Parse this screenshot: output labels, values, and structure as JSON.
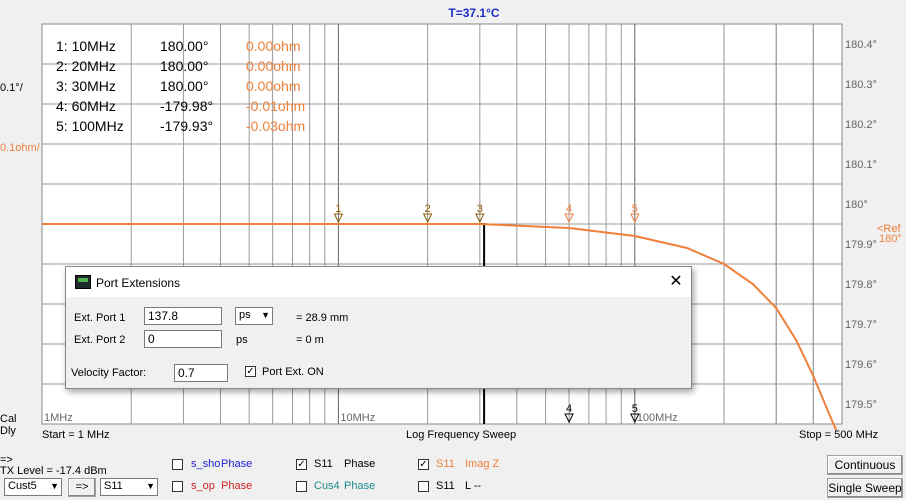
{
  "chart_data": {
    "type": "line",
    "title": "T=37.1°C",
    "x_scale": "log",
    "xlim": [
      1,
      500
    ],
    "x_tick_labels": [
      "1MHz",
      "10MHz",
      "100MHz"
    ],
    "y_tick_labels_right": [
      "180.4°",
      "180.3°",
      "180.2°",
      "180.1°",
      "180°",
      "179.9°",
      "179.8°",
      "179.7°",
      "179.6°",
      "179.5°"
    ],
    "ylim": [
      179.5,
      180.5
    ],
    "scale_labels": {
      "phase": "0.1°/",
      "imag": "0.1ohm/"
    },
    "ref_label": "<Ref",
    "ref_value": "180°",
    "series": [
      {
        "name": "S11 Phase",
        "color": "#000000",
        "x": [
          1,
          3,
          20,
          31,
          31
        ],
        "y": [
          180,
          180,
          180,
          180,
          179.5
        ]
      },
      {
        "name": "S11 Imag Z",
        "color": "#f07f3a",
        "x": [
          1,
          10,
          30,
          60,
          100,
          150,
          200,
          250,
          300,
          350,
          400,
          450,
          500
        ],
        "y": [
          180,
          180,
          180,
          179.99,
          179.97,
          179.94,
          179.9,
          179.85,
          179.79,
          179.71,
          179.62,
          179.53,
          179.45
        ]
      }
    ],
    "markers_top": [
      {
        "label": "1",
        "x": 10
      },
      {
        "label": "2",
        "x": 20
      },
      {
        "label": "3",
        "x": 30
      },
      {
        "label": "4",
        "x": 60
      },
      {
        "label": "5",
        "x": 100
      }
    ],
    "markers_bottom": [
      {
        "label": "4",
        "x": 60
      },
      {
        "label": "5",
        "x": 100
      }
    ],
    "readouts": [
      {
        "label": "1: 10MHz",
        "phase": "180.00°",
        "imag": "0.00ohm"
      },
      {
        "label": "2: 20MHz",
        "phase": "180.00°",
        "imag": "0.00ohm"
      },
      {
        "label": "3: 30MHz",
        "phase": "180.00°",
        "imag": "0.00ohm"
      },
      {
        "label": "4: 60MHz",
        "phase": "-179.98°",
        "imag": "-0.01ohm"
      },
      {
        "label": "5: 100MHz",
        "phase": "-179.93°",
        "imag": "-0.03ohm"
      }
    ],
    "grid": true
  },
  "left_labels": {
    "cal": "Cal",
    "dly": "Dly"
  },
  "sweep": {
    "start": "Start = 1 MHz",
    "mode": "Log Frequency Sweep",
    "stop": "Stop = 500 MHz"
  },
  "controls": {
    "arrow_label": "=>",
    "tx_level": "TX Level = -17.4 dBm",
    "preset_select": "Cust5",
    "apply_button": "=>",
    "param_select": "S11",
    "traces": [
      {
        "name": "s_sho",
        "suffix": "Phase",
        "checked": false,
        "color": "#2222cc"
      },
      {
        "name": "s_op",
        "suffix": "Phase",
        "checked": false,
        "color": "#cc2222"
      },
      {
        "name": "S11",
        "suffix": "Phase",
        "checked": true,
        "color": "#000000"
      },
      {
        "name": "Cus4",
        "suffix": "Phase",
        "checked": false,
        "color": "#1a8c8c"
      },
      {
        "name": "S11",
        "suffix": "Imag Z",
        "checked": true,
        "color": "#f07f3a"
      },
      {
        "name": "S11",
        "suffix": "L --",
        "checked": false,
        "color": "#000000"
      }
    ],
    "continuous_button": "Continuous",
    "single_sweep_button": "Single Sweep"
  },
  "dialog": {
    "title": "Port Extensions",
    "close_glyph": "✕",
    "port1_label": "Ext. Port 1",
    "port1_value": "137.8",
    "port1_unit": "ps",
    "port1_result": "= 28.9 mm",
    "port2_label": "Ext. Port 2",
    "port2_value": "0",
    "port2_unit": "ps",
    "port2_result": "= 0 m",
    "velocity_label": "Velocity Factor:",
    "velocity_value": "0.7",
    "portext_label": "Port Ext. ON",
    "portext_checked": true
  }
}
